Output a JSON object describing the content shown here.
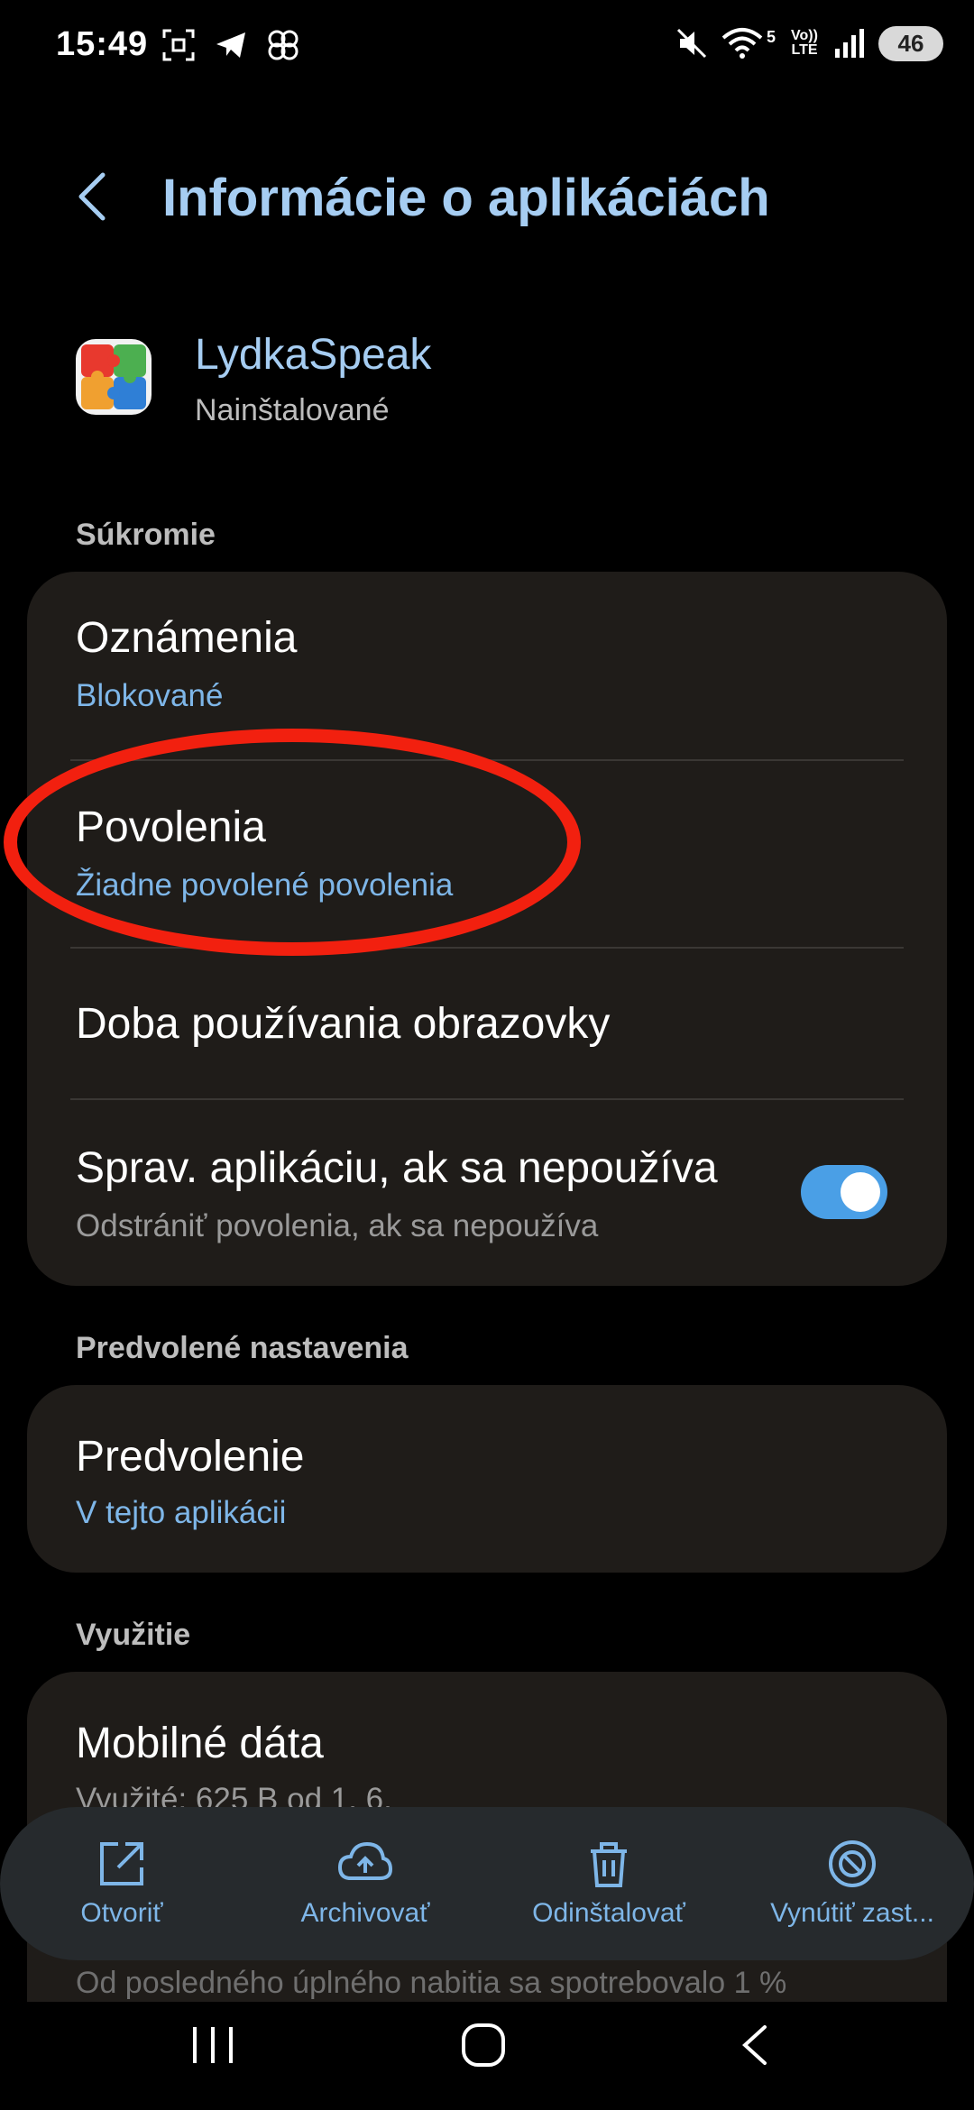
{
  "status_bar": {
    "time": "15:49",
    "network_5g": "5",
    "volte": "Vo)) LTE",
    "battery": "46"
  },
  "header": {
    "back_icon": "back-chevron-icon",
    "title": "Informácie o aplikáciách"
  },
  "app": {
    "name": "LydkaSpeak",
    "status": "Nainštalované"
  },
  "sections": {
    "privacy": {
      "label": "Súkromie",
      "items": [
        {
          "title": "Oznámenia",
          "subtitle": "Blokované"
        },
        {
          "title": "Povolenia",
          "subtitle": "Žiadne povolené povolenia"
        },
        {
          "title": "Doba používania obrazovky"
        },
        {
          "title": "Sprav. aplikáciu, ak sa nepoužíva",
          "subtitle": "Odstrániť povolenia, ak sa nepoužíva",
          "toggle_on": true
        }
      ]
    },
    "defaults": {
      "label": "Predvolené nastavenia",
      "items": [
        {
          "title": "Predvolenie",
          "subtitle": "V tejto aplikácii"
        }
      ]
    },
    "usage": {
      "label": "Využitie",
      "items": [
        {
          "title": "Mobilné dáta",
          "subtitle": "Využité: 625 B od 1. 6."
        }
      ]
    }
  },
  "battery_usage_text": "Od posledného úplného nabitia sa spotrebovalo 1 %",
  "actions": [
    {
      "label": "Otvoriť",
      "icon": "open-external-icon"
    },
    {
      "label": "Archivovať",
      "icon": "cloud-upload-icon"
    },
    {
      "label": "Odinštalovať",
      "icon": "trash-icon"
    },
    {
      "label": "Vynútiť zast...",
      "icon": "block-icon"
    }
  ],
  "colors": {
    "accent": "#a6cdf2",
    "link": "#7eb6e8",
    "card": "#1f1c19",
    "toggle": "#4a9fe6",
    "highlight": "#f2200f"
  }
}
